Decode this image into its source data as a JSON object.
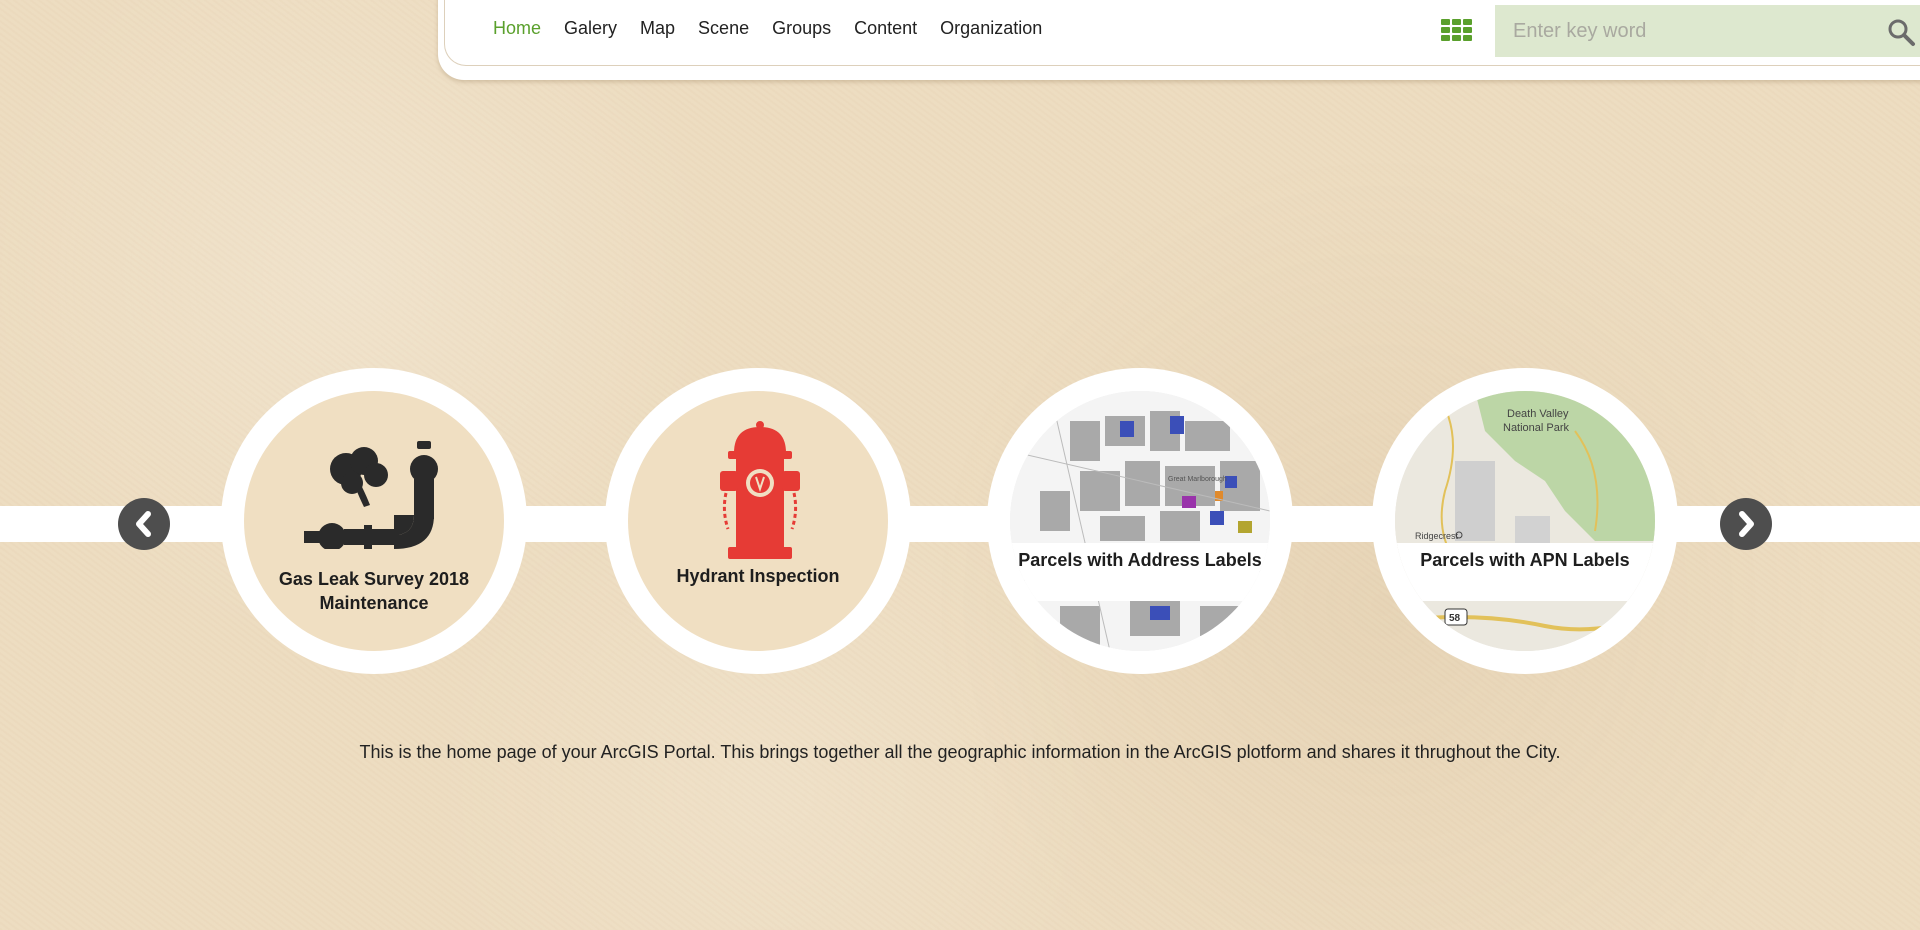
{
  "nav": {
    "items": [
      {
        "label": "Home",
        "active": true
      },
      {
        "label": "Galery",
        "active": false
      },
      {
        "label": "Map",
        "active": false
      },
      {
        "label": "Scene",
        "active": false
      },
      {
        "label": "Groups",
        "active": false
      },
      {
        "label": "Content",
        "active": false
      },
      {
        "label": "Organization",
        "active": false
      }
    ]
  },
  "search": {
    "placeholder": "Enter key word",
    "icon": "search-icon"
  },
  "apps_icon": "grid-apps-icon",
  "accent_color": "#5aa02c",
  "carousel": {
    "cards": [
      {
        "title": "Gas Leak Survey 2018 Maintenance",
        "icon": "gas-leak-icon"
      },
      {
        "title": "Hydrant Inspection",
        "icon": "fire-hydrant-icon"
      },
      {
        "title": "Parcels with Address Labels",
        "thumbnail": "parcel-map"
      },
      {
        "title": "Parcels with APN Labels",
        "thumbnail": "death-valley-map"
      }
    ],
    "map_labels": {
      "park": "Death Valley",
      "park2": "National Park",
      "town": "Ridgecrest",
      "route": "58",
      "street": "Great Marlborough"
    },
    "prev_icon": "chevron-left-icon",
    "next_icon": "chevron-right-icon"
  },
  "intro_text": "This is the home page of your  ArcGIS Portal. This brings together all the geographic information in the ArcGIS  plotform and shares it thrughout the City."
}
